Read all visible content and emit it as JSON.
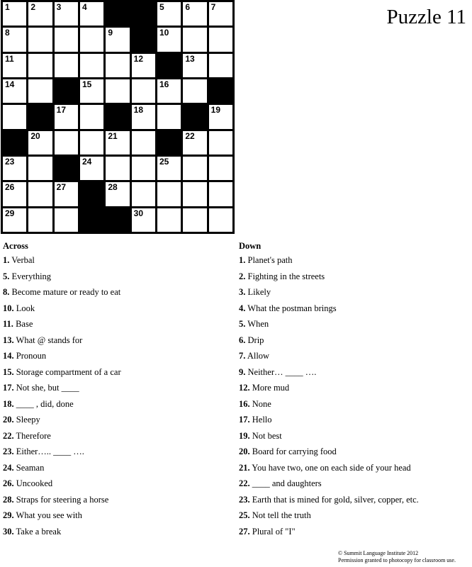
{
  "title": "Puzzle 11",
  "grid": {
    "rows": [
      [
        "1",
        "2",
        "3",
        "4",
        "#",
        "#",
        "5",
        "6",
        "7"
      ],
      [
        "8",
        "",
        "",
        "",
        "9",
        "#",
        "10",
        "",
        ""
      ],
      [
        "11",
        "",
        "",
        "",
        "",
        "12",
        "#",
        "13",
        ""
      ],
      [
        "14",
        "",
        "#",
        "15",
        "",
        "",
        "16",
        "",
        "#"
      ],
      [
        "",
        "#",
        "17",
        "",
        "#",
        "18",
        "",
        "#",
        "19"
      ],
      [
        "#",
        "20",
        "",
        "",
        "21",
        "",
        "#",
        "22",
        ""
      ],
      [
        "23",
        "",
        "#",
        "24",
        "",
        "",
        "25",
        "",
        ""
      ],
      [
        "26",
        "",
        "27",
        "#",
        "28",
        "",
        "",
        "",
        ""
      ],
      [
        "29",
        "",
        "",
        "#",
        "#",
        "30",
        "",
        "",
        ""
      ]
    ]
  },
  "across": {
    "heading": "Across",
    "clues": [
      {
        "num": "1.",
        "text": "Verbal"
      },
      {
        "num": "5.",
        "text": "Everything"
      },
      {
        "num": "8.",
        "text": "Become mature or ready to eat"
      },
      {
        "num": "10.",
        "text": "Look"
      },
      {
        "num": "11.",
        "text": "Base"
      },
      {
        "num": "13.",
        "text": "What @ stands for"
      },
      {
        "num": "14.",
        "text": "Pronoun"
      },
      {
        "num": "15.",
        "text": "Storage compartment of a car"
      },
      {
        "num": "17.",
        "text": "Not she, but ____"
      },
      {
        "num": "18.",
        "text": "____ , did, done"
      },
      {
        "num": "20.",
        "text": "Sleepy"
      },
      {
        "num": "22.",
        "text": "Therefore"
      },
      {
        "num": "23.",
        "text": "Either….. ____ …."
      },
      {
        "num": "24.",
        "text": "Seaman"
      },
      {
        "num": "26.",
        "text": "Uncooked"
      },
      {
        "num": "28.",
        "text": "Straps for steering a horse"
      },
      {
        "num": "29.",
        "text": "What you see with"
      },
      {
        "num": "30.",
        "text": "Take a break"
      }
    ]
  },
  "down": {
    "heading": "Down",
    "clues": [
      {
        "num": "1.",
        "text": "Planet's path"
      },
      {
        "num": "2.",
        "text": "Fighting in the streets"
      },
      {
        "num": "3.",
        "text": "Likely"
      },
      {
        "num": "4.",
        "text": "What the postman brings"
      },
      {
        "num": "5.",
        "text": "When"
      },
      {
        "num": "6.",
        "text": "Drip"
      },
      {
        "num": "7.",
        "text": "Allow"
      },
      {
        "num": "9.",
        "text": "Neither… ____ …."
      },
      {
        "num": "12.",
        "text": "More mud"
      },
      {
        "num": "16.",
        "text": "None"
      },
      {
        "num": "17.",
        "text": "Hello"
      },
      {
        "num": "19.",
        "text": "Not best"
      },
      {
        "num": "20.",
        "text": "Board for carrying food"
      },
      {
        "num": "21.",
        "text": "You have two, one on each side of your head"
      },
      {
        "num": "22.",
        "text": "____ and daughters"
      },
      {
        "num": "23.",
        "text": "Earth that is mined for gold, silver, copper, etc."
      },
      {
        "num": "25.",
        "text": "Not tell the truth"
      },
      {
        "num": "27.",
        "text": "Plural of \"I\""
      }
    ]
  },
  "footer": {
    "line1": "© Summit Language Institute 2012",
    "line2": "Permission granted to photocopy for classroom use."
  }
}
